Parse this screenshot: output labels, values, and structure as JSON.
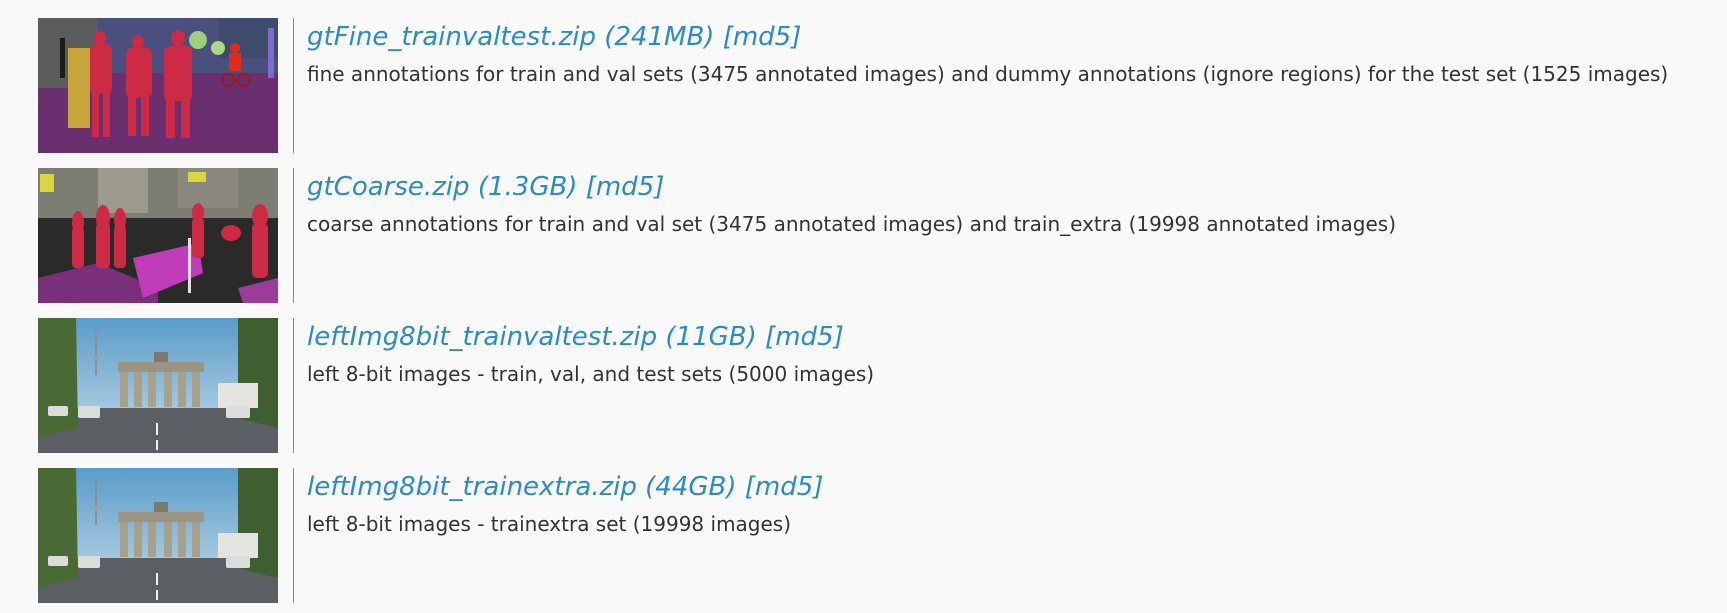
{
  "colors": {
    "background": "#f9f9f9",
    "link": "#2a8bc6",
    "text": "#333333",
    "divider": "#8a8a8a"
  },
  "downloads": [
    {
      "title": "gtFine_trainvaltest.zip (241MB) [md5]",
      "description": "fine annotations for train and val sets (3475 annotated images) and dummy annotations (ignore regions) for the test set (1525 images)"
    },
    {
      "title": "gtCoarse.zip (1.3GB) [md5]",
      "description": "coarse annotations for train and val set (3475 annotated images) and train_extra (19998 annotated images)"
    },
    {
      "title": "leftImg8bit_trainvaltest.zip (11GB) [md5]",
      "description": "left 8-bit images - train, val, and test sets (5000 images)"
    },
    {
      "title": "leftImg8bit_trainextra.zip (44GB) [md5]",
      "description": "left 8-bit images - trainextra set (19998 images)"
    }
  ]
}
